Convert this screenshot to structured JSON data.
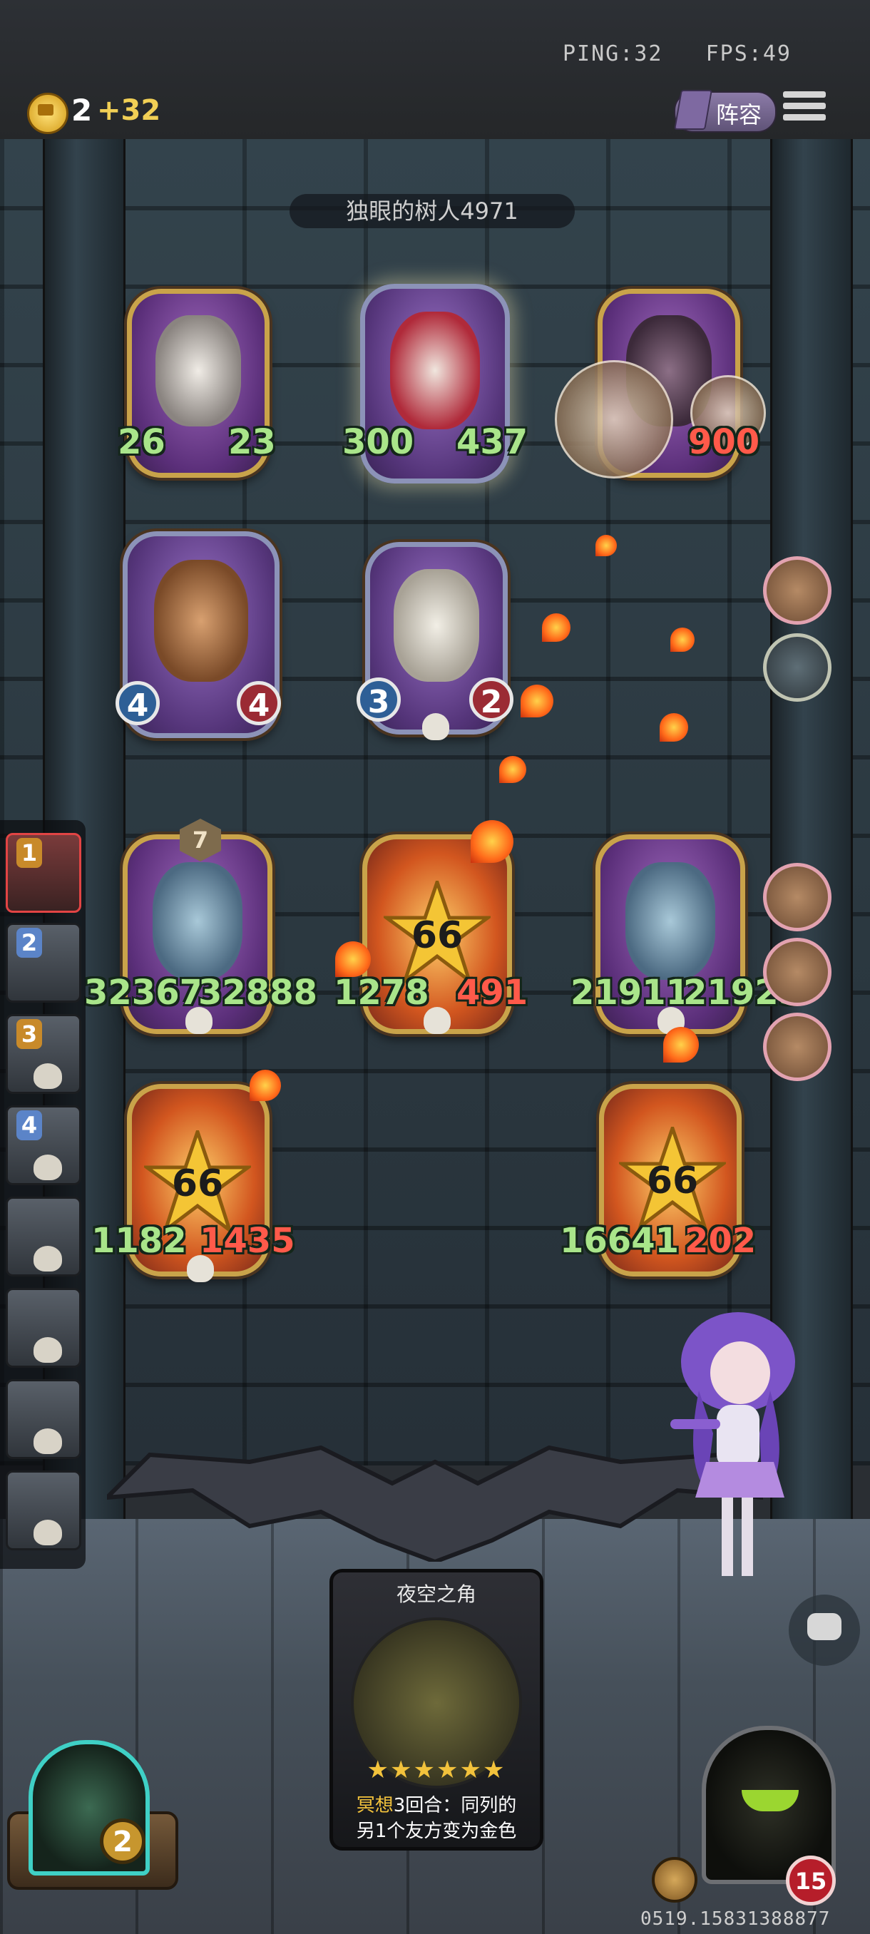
{
  "hud": {
    "ping": "PING:32",
    "fps": "FPS:49",
    "gold": "2",
    "gold_income": "+32",
    "lineup_label": "阵容"
  },
  "enemy": {
    "name": "独眼的树人4971"
  },
  "enemy_board": [
    {
      "name": "rabbit-mask-minion",
      "attack": "26",
      "health": "23",
      "frame": "gold"
    },
    {
      "name": "clown-minion",
      "attack": "300",
      "health": "437",
      "frame": "silver"
    },
    {
      "name": "pirate-minion",
      "attack": "",
      "health": "900",
      "frame": "gold"
    },
    {
      "name": "monkey-minion",
      "attack": "4",
      "health": "4",
      "frame": "silver",
      "orb_stats": true
    },
    {
      "name": "pelican-minion",
      "attack": "3",
      "health": "2",
      "frame": "silver",
      "orb_stats": true
    }
  ],
  "player_board": [
    {
      "name": "mech-diver-minion-left",
      "attack": "32367",
      "health": "32888",
      "badge": "7"
    },
    {
      "name": "burning-minion-center",
      "attack": "1278",
      "health": "491",
      "damage": "66"
    },
    {
      "name": "mech-diver-minion-right",
      "attack": "21911",
      "health": "21925"
    },
    {
      "name": "burning-minion-bottom-left",
      "attack": "1182",
      "health": "1435",
      "damage": "66"
    },
    {
      "name": "burning-minion-bottom-right",
      "attack": "16641",
      "health": "202",
      "damage": "66"
    }
  ],
  "roster": [
    {
      "rank": "1",
      "active": true,
      "rank_color": "#c88a2a"
    },
    {
      "rank": "2",
      "active": false,
      "rank_color": "#5b84c8"
    },
    {
      "rank": "3",
      "active": false,
      "rank_color": "#c88a2a"
    },
    {
      "rank": "4",
      "active": false,
      "rank_color": "#5b84c8"
    },
    {
      "rank": "",
      "active": false
    },
    {
      "rank": "",
      "active": false
    },
    {
      "rank": "",
      "active": false
    },
    {
      "rank": "",
      "active": false
    }
  ],
  "hand_card": {
    "title": "夜空之角",
    "stars": "★★★★★★",
    "keyword": "冥想",
    "desc_rest": "3回合：同列的",
    "desc_line2": "另1个友方变为金色"
  },
  "hero": {
    "level": "2"
  },
  "opponent": {
    "health": "15"
  },
  "footer": {
    "id": "0519.15831388877"
  },
  "colors": {
    "stat_green": "#a9e58a",
    "stat_red": "#ff5a4a",
    "gold_frame": "#c9a34a",
    "accent_yellow": "#f2c23c"
  }
}
